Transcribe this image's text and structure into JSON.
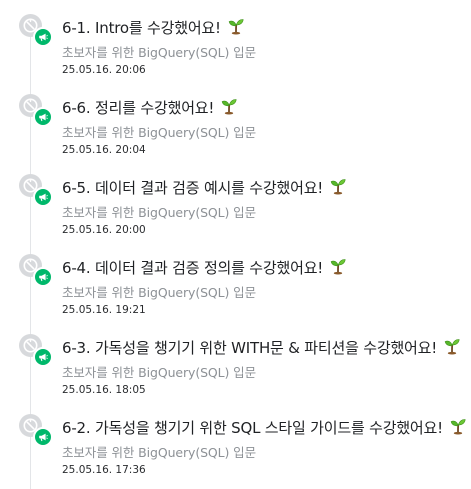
{
  "items": [
    {
      "title": "6-1. Intro를 수강했어요!",
      "course": "초보자를 위한 BigQuery(SQL) 입문",
      "time": "25.05.16. 20:06",
      "badge_icon": "megaphone-icon",
      "emoji_icon": "sprout-icon"
    },
    {
      "title": "6-6. 정리를 수강했어요!",
      "course": "초보자를 위한 BigQuery(SQL) 입문",
      "time": "25.05.16. 20:04",
      "badge_icon": "megaphone-icon",
      "emoji_icon": "sprout-icon"
    },
    {
      "title": "6-5. 데이터 결과 검증 예시를 수강했어요!",
      "course": "초보자를 위한 BigQuery(SQL) 입문",
      "time": "25.05.16. 20:00",
      "badge_icon": "megaphone-icon",
      "emoji_icon": "sprout-icon"
    },
    {
      "title": "6-4. 데이터 결과 검증 정의를 수강했어요!",
      "course": "초보자를 위한 BigQuery(SQL) 입문",
      "time": "25.05.16. 19:21",
      "badge_icon": "megaphone-icon",
      "emoji_icon": "sprout-icon"
    },
    {
      "title": "6-3. 가독성을 챙기기 위한 WITH문 & 파티션을 수강했어요!",
      "course": "초보자를 위한 BigQuery(SQL) 입문",
      "time": "25.05.16. 18:05",
      "badge_icon": "megaphone-icon",
      "emoji_icon": "sprout-icon"
    },
    {
      "title": "6-2. 가독성을 챙기기 위한 SQL 스타일 가이드를 수강했어요!",
      "course": "초보자를 위한 BigQuery(SQL) 입문",
      "time": "25.05.16. 17:36",
      "badge_icon": "megaphone-icon",
      "emoji_icon": "sprout-icon"
    }
  ],
  "colors": {
    "badge": "#00b86b",
    "avatar": "#d7d9dc",
    "course_text": "#8d9196"
  }
}
